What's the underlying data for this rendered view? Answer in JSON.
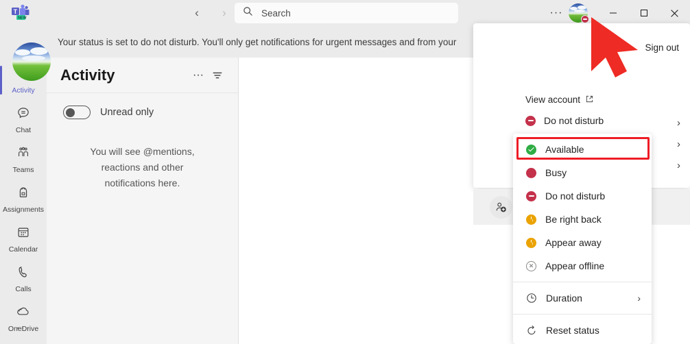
{
  "window": {
    "app_logo": "teams-logo",
    "logo_badge": "NEW",
    "minimize": "‒",
    "maximize": "☐",
    "close": "✕",
    "more_options": "···"
  },
  "titlebar": {
    "back": "‹",
    "forward": "›",
    "search_placeholder": "Search",
    "search_icon": "search-icon"
  },
  "banner": {
    "text": "Your status is set to do not disturb. You'll only get notifications for urgent messages and from your"
  },
  "rail": {
    "items": [
      {
        "label": "Activity",
        "icon": "bell-icon",
        "active": true
      },
      {
        "label": "Chat",
        "icon": "chat-icon",
        "active": false
      },
      {
        "label": "Teams",
        "icon": "teams-icon",
        "active": false
      },
      {
        "label": "Assignments",
        "icon": "backpack-icon",
        "active": false
      },
      {
        "label": "Calendar",
        "icon": "calendar-icon",
        "active": false
      },
      {
        "label": "Calls",
        "icon": "phone-icon",
        "active": false
      },
      {
        "label": "OneDrive",
        "icon": "onedrive-icon",
        "active": false
      }
    ],
    "more": "···"
  },
  "activity_panel": {
    "title": "Activity",
    "more_label": "···",
    "filter_icon": "filter-icon",
    "toggle_label": "Unread only",
    "toggle_on": false,
    "empty_state": "You will see @mentions, reactions and other notifications here."
  },
  "profile_flyout": {
    "sign_out": "Sign out",
    "avatar": "user-avatar",
    "view_account": "View account",
    "external_link_icon": "⧉",
    "current_status": "Do not disturb",
    "chevron": "›",
    "add_account_icon": "add-person-icon"
  },
  "status_menu": {
    "items": [
      {
        "label": "Available",
        "state": "available",
        "highlighted": true
      },
      {
        "label": "Busy",
        "state": "busy",
        "highlighted": false
      },
      {
        "label": "Do not disturb",
        "state": "dnd",
        "highlighted": false
      },
      {
        "label": "Be right back",
        "state": "away",
        "highlighted": false
      },
      {
        "label": "Appear away",
        "state": "away",
        "highlighted": false
      },
      {
        "label": "Appear offline",
        "state": "offline",
        "highlighted": false
      }
    ],
    "duration": {
      "label": "Duration",
      "icon": "clock-icon",
      "chevron": "›"
    },
    "reset": {
      "label": "Reset status",
      "icon": "reset-icon"
    }
  },
  "colors": {
    "accent": "#5b5fc7",
    "available": "#2fac44",
    "busy": "#c4314b",
    "dnd": "#c4314b",
    "away": "#eaa300",
    "offline": "#8a8886",
    "highlight": "#ee1c25",
    "cursor": "#ee2b24"
  }
}
